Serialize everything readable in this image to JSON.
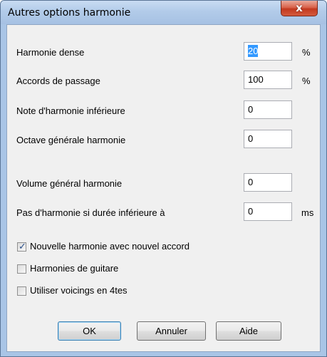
{
  "window": {
    "title": "Autres options harmonie",
    "close_glyph": "x"
  },
  "fields": [
    {
      "label": "Harmonie dense",
      "value": "20",
      "unit": "%",
      "selected": true
    },
    {
      "label": "Accords de passage",
      "value": "100",
      "unit": "%"
    },
    {
      "label": "Note d'harmonie inférieure",
      "value": "0",
      "unit": ""
    },
    {
      "label": "Octave générale harmonie",
      "value": "0",
      "unit": ""
    },
    {
      "label": "Volume général harmonie",
      "value": "0",
      "unit": ""
    },
    {
      "label": "Pas d'harmonie si durée inférieure à",
      "value": "0",
      "unit": "ms"
    }
  ],
  "checkboxes": [
    {
      "label": "Nouvelle harmonie avec nouvel accord",
      "checked": true
    },
    {
      "label": "Harmonies de guitare",
      "checked": false
    },
    {
      "label": "Utiliser voicings en 4tes",
      "checked": false
    }
  ],
  "buttons": {
    "ok": "OK",
    "cancel": "Annuler",
    "help": "Aide"
  },
  "icons": {
    "check": "✓",
    "close": "close-icon"
  }
}
